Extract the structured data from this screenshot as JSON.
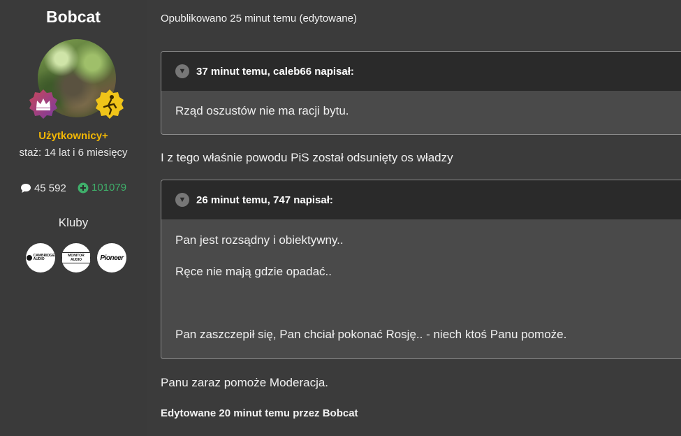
{
  "author": {
    "name": "Bobcat",
    "group": "Użytkownicy+",
    "tenure": "staż: 14 lat i 6 miesięcy",
    "posts_count": "45 592",
    "reputation": "101079",
    "clubs_title": "Kluby",
    "clubs": [
      {
        "name": "CAMBRIDGE AUDIO",
        "line1": "CAMBRIDGE",
        "line2": "AUDIO"
      },
      {
        "name": "MONITOR AUDIO",
        "label": "MONITOR AUDIO"
      },
      {
        "name": "Pioneer",
        "label": "Pioneer"
      }
    ],
    "colors": {
      "group": "#f2b705",
      "reputation": "#3fae6a"
    }
  },
  "post": {
    "published": "Opublikowano 25 minut temu (edytowane)",
    "quotes": [
      {
        "header": "37 minut temu, caleb66 napisał:",
        "lines": [
          "Rząd oszustów nie ma racji bytu."
        ]
      },
      {
        "header": "26 minut temu, 747 napisał:",
        "lines": [
          "Pan jest rozsądny i obiektywny..",
          "Ręce nie mają gdzie opadać..",
          "Pan zaszczepił się, Pan chciał pokonać Rosję.. - niech ktoś Panu pomoże."
        ]
      }
    ],
    "paragraph1": "I z tego właśnie powodu PiS został odsunięty os władzy",
    "paragraph2": "Panu zaraz pomoże Moderacja.",
    "edited": "Edytowane 20 minut temu przez Bobcat"
  }
}
